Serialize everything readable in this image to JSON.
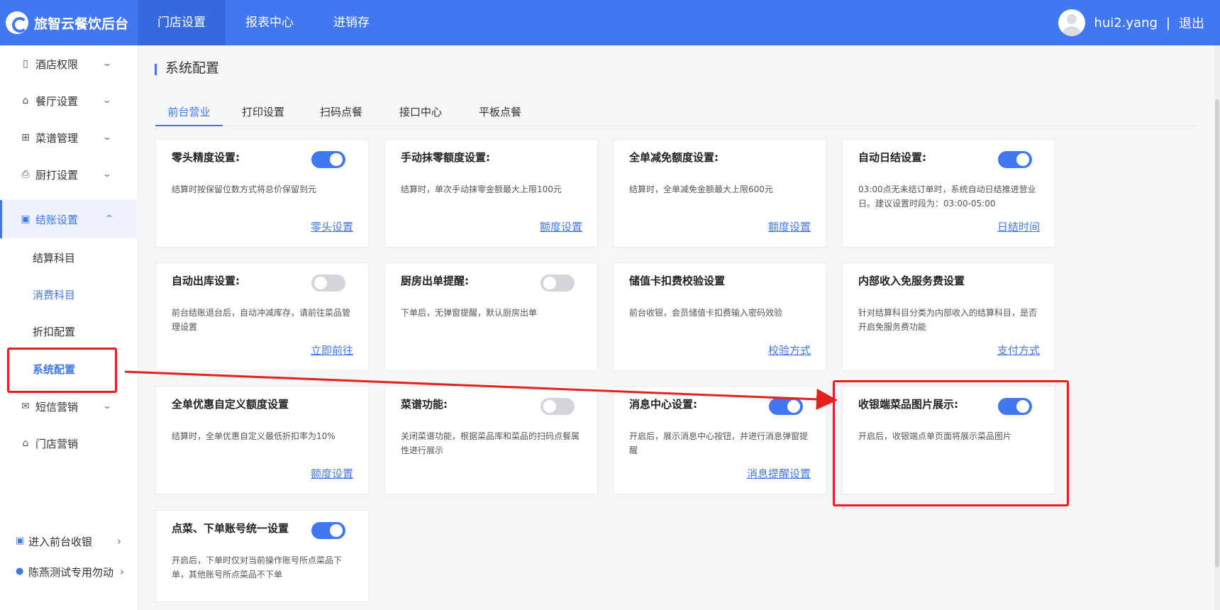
{
  "app": {
    "brand": "旅智云餐饮后台"
  },
  "topnav": {
    "items": [
      "门店设置",
      "报表中心",
      "进销存"
    ]
  },
  "user": {
    "name": "hui2.yang",
    "separator": "|",
    "logout": "退出"
  },
  "sidebar": {
    "items": [
      {
        "label": "酒店权限",
        "icon": "building-icon"
      },
      {
        "label": "餐厅设置",
        "icon": "cloche-icon"
      },
      {
        "label": "菜谱管理",
        "icon": "grid-icon"
      },
      {
        "label": "厨打设置",
        "icon": "printer-icon"
      },
      {
        "label": "结账设置",
        "icon": "checkout-icon"
      }
    ],
    "sub_items": [
      "结算科目",
      "消费科目",
      "折扣配置",
      "系统配置"
    ],
    "more_items": [
      {
        "label": "短信营销",
        "icon": "mail-icon"
      },
      {
        "label": "门店营销",
        "icon": "store-icon"
      }
    ],
    "bottom": {
      "enter_cashier": "进入前台收银",
      "store_name": "陈燕测试专用勿动"
    }
  },
  "page": {
    "title": "系统配置"
  },
  "tabs": [
    "前台营业",
    "打印设置",
    "扫码点餐",
    "接口中心",
    "平板点餐"
  ],
  "cards": [
    {
      "title": "零头精度设置:",
      "desc": "结算时按保留位数方式将总价保留到元",
      "link": "零头设置",
      "toggle": "on"
    },
    {
      "title": "手动抹零额度设置:",
      "desc": "结算时，单次手动抹零金额最大上限100元",
      "link": "额度设置",
      "toggle": "none"
    },
    {
      "title": "全单减免额度设置:",
      "desc": "结算时，全单减免金额最大上限600元",
      "link": "额度设置",
      "toggle": "none"
    },
    {
      "title": "自动日结设置:",
      "desc": "03:00点无未结订单时，系统自动日结推进营业日。建议设置时段为：03:00-05:00",
      "link": "日结时间",
      "toggle": "on"
    },
    {
      "title": "自动出库设置:",
      "desc": "前台结账退台后，自动冲减库存，请前往菜品管理设置",
      "link": "立即前往",
      "toggle": "off"
    },
    {
      "title": "厨房出单提醒:",
      "desc": "下单后，无弹窗提醒，默认厨房出单",
      "link": "",
      "toggle": "off"
    },
    {
      "title": "储值卡扣费校验设置",
      "desc": "前台收银，会员储值卡扣费输入密码效验",
      "link": "校验方式",
      "toggle": "none"
    },
    {
      "title": "内部收入免服务费设置",
      "desc": "针对结算科目分类为内部收入的结算科目，是否开启免服务费功能",
      "link": "支付方式",
      "toggle": "none"
    },
    {
      "title": "全单优惠自定义额度设置",
      "desc": "结算时，全单优惠自定义最低折扣率为10%",
      "link": "额度设置",
      "toggle": "none"
    },
    {
      "title": "菜谱功能:",
      "desc": "关闭菜谱功能，根据菜品库和菜品的扫码点餐属性进行展示",
      "link": "",
      "toggle": "off"
    },
    {
      "title": "消息中心设置:",
      "desc": "开启后，展示消息中心按钮，并进行消息弹窗提醒",
      "link": "消息提醒设置",
      "toggle": "on"
    },
    {
      "title": "收银端菜品图片展示:",
      "desc": "开启后，收银端点单页面将展示菜品图片",
      "link": "",
      "toggle": "on"
    },
    {
      "title": "点菜、下单账号统一设置",
      "desc": "开启后，下单时仅对当前操作账号所点菜品下单，其他账号所点菜品不下单",
      "link": "",
      "toggle": "on"
    }
  ],
  "colors": {
    "primary": "#4178f2",
    "highlight": "#e8201b"
  }
}
